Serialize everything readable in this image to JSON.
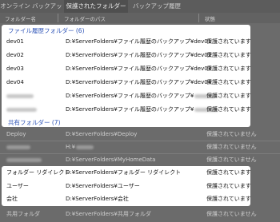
{
  "tabs": [
    "オンライン バックアップ",
    "保護されたフォルダー",
    "バックアップ履歴"
  ],
  "columns": {
    "name": "フォルダー名",
    "path": "フォルダーのパス",
    "status": "状態"
  },
  "history_group": {
    "title": "ファイル履歴フォルダー (6)",
    "rows": [
      {
        "name": "dev01",
        "path": "D:¥ServerFolders¥ファイル履歴のバックアップ¥dev01",
        "status": "保護されています"
      },
      {
        "name": "dev02",
        "path": "D:¥ServerFolders¥ファイル履歴のバックアップ¥dev02",
        "status": "保護されています"
      },
      {
        "name": "dev03",
        "path": "D:¥ServerFolders¥ファイル履歴のバックアップ¥dev03",
        "status": "保護されています"
      },
      {
        "name": "dev04",
        "path": "D:¥ServerFolders¥ファイル履歴のバックアップ¥dev04",
        "status": "保護されています"
      },
      {
        "name": "",
        "path": "D:¥ServerFolders¥ファイル履歴のバックアップ¥",
        "status": "保護されています"
      },
      {
        "name": "",
        "path": "D:¥ServerFolders¥ファイル履歴のバックアップ¥",
        "status": "保護されています"
      }
    ]
  },
  "shared_group": {
    "title": "共有フォルダー (7)"
  },
  "dim_rows": [
    {
      "name": "Deploy",
      "path": "D:¥ServerFolders¥Deploy",
      "status": "保護されていません"
    },
    {
      "name": "",
      "path": "H:¥",
      "status": "保護されていません"
    },
    {
      "name": "",
      "path": "D:¥ServerFolders¥MyHomeData",
      "status": "保護されていません"
    }
  ],
  "shared_rows": [
    {
      "name": "フォルダー リダイレクト",
      "path": "D:¥ServerFolders¥フォルダー リダイレクト",
      "status": "保護されています"
    },
    {
      "name": "ユーザー",
      "path": "D:¥ServerFolders¥ユーザー",
      "status": "保護されています"
    },
    {
      "name": "会社",
      "path": "D:¥ServerFolders¥会社",
      "status": "保護されています"
    }
  ],
  "bottom_row": {
    "name": "共用フォルダ",
    "path": "D:¥ServerFolders¥共用フォルダ",
    "status": "保護されていません"
  }
}
